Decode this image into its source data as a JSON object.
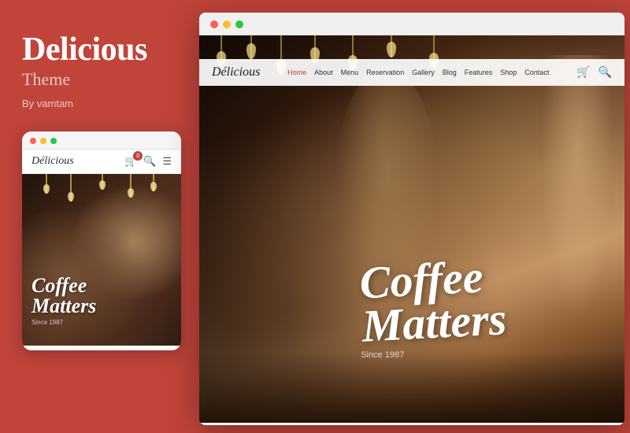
{
  "left": {
    "title": "Delicious",
    "subtitle": "Theme",
    "author": "By vamtam",
    "bg_color": "#c0443a"
  },
  "mobile": {
    "dots": [
      "red",
      "yellow",
      "green"
    ],
    "logo": "Délicious",
    "cart_count": "0",
    "hero_text_line1": "Coffee",
    "hero_text_line2": "Matters",
    "since": "Since 1987"
  },
  "desktop": {
    "dots": [
      "red",
      "yellow",
      "green"
    ],
    "logo": "Délicious",
    "nav_links": [
      "Home",
      "About",
      "Menu",
      "Reservation",
      "Gallery",
      "Blog",
      "Features",
      "Shop",
      "Contact"
    ],
    "hero_text_line1": "Coffee",
    "hero_text_line2": "Matters",
    "since": "Since 1987"
  }
}
